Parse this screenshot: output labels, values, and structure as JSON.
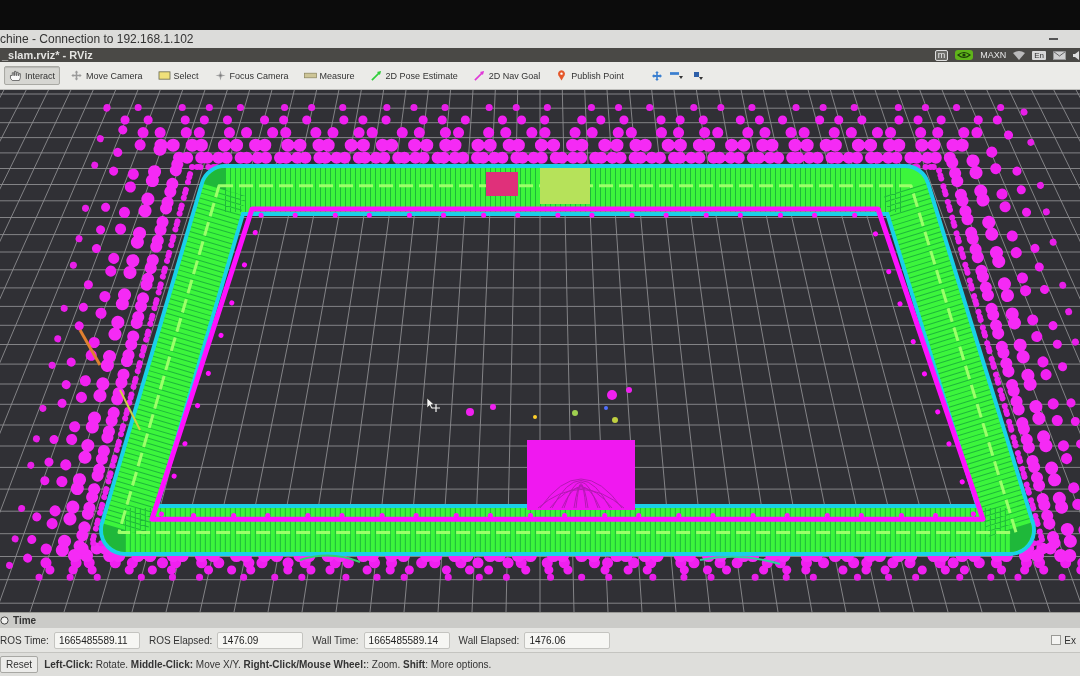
{
  "window": {
    "title": "chine - Connection to 192.168.1.102"
  },
  "panel_bar": {
    "title": "_slam.rviz* - RViz",
    "app_badge": "m",
    "power_mode": "MAXN",
    "keyboard_layout": "En"
  },
  "toolbar": {
    "tools": [
      {
        "kind": "interact",
        "label": "Interact",
        "selected": true
      },
      {
        "kind": "move",
        "label": "Move Camera",
        "selected": false
      },
      {
        "kind": "select",
        "label": "Select",
        "selected": false
      },
      {
        "kind": "focus",
        "label": "Focus Camera",
        "selected": false
      },
      {
        "kind": "measure",
        "label": "Measure",
        "selected": false
      },
      {
        "kind": "pose",
        "label": "2D Pose Estimate",
        "selected": false
      },
      {
        "kind": "goal",
        "label": "2D Nav Goal",
        "selected": false
      },
      {
        "kind": "point",
        "label": "Publish Point",
        "selected": false
      }
    ]
  },
  "time_panel": {
    "title": "Time",
    "fields": [
      {
        "label": "ROS Time:",
        "value": "1665485589.11"
      },
      {
        "label": "ROS Elapsed:",
        "value": "1476.09"
      },
      {
        "label": "Wall Time:",
        "value": "1665485589.14"
      },
      {
        "label": "Wall Elapsed:",
        "value": "1476.06"
      }
    ],
    "experimental": {
      "label": "Ex",
      "checked": false
    }
  },
  "status_bar": {
    "reset_button": "Reset",
    "hint": "**Left-Click:** Rotate. **Middle-Click:** Move X/Y. **Right-Click/Mouse Wheel:**: Zoom. **Shift**: More options."
  }
}
